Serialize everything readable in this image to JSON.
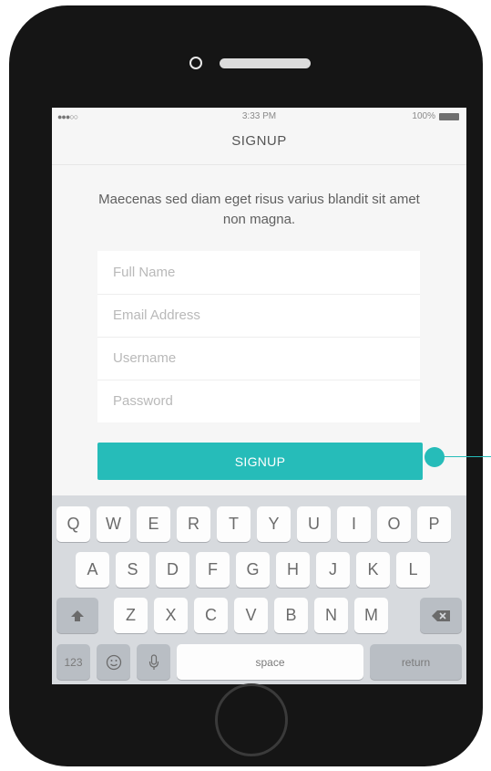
{
  "status_bar": {
    "signal": "●●●○○",
    "time": "3:33 PM",
    "battery": "100%"
  },
  "nav": {
    "title": "SIGNUP"
  },
  "intro_text": "Maecenas sed diam eget risus varius blandit sit amet non magna.",
  "form": {
    "fields": [
      {
        "placeholder": "Full Name",
        "value": ""
      },
      {
        "placeholder": "Email Address",
        "value": ""
      },
      {
        "placeholder": "Username",
        "value": ""
      },
      {
        "placeholder": "Password",
        "value": ""
      }
    ],
    "submit_label": "SIGNUP"
  },
  "keyboard": {
    "row1": [
      "Q",
      "W",
      "E",
      "R",
      "T",
      "Y",
      "U",
      "I",
      "O",
      "P"
    ],
    "row2": [
      "A",
      "S",
      "D",
      "F",
      "G",
      "H",
      "J",
      "K",
      "L"
    ],
    "row3": [
      "Z",
      "X",
      "C",
      "V",
      "B",
      "N",
      "M"
    ],
    "numbers_label": "123",
    "space_label": "space",
    "return_label": "return",
    "icons": {
      "shift": "shift-icon",
      "backspace": "backspace-icon",
      "emoji": "emoji-icon",
      "mic": "microphone-icon"
    }
  },
  "colors": {
    "accent": "#26bcb9",
    "phone_body": "#151515",
    "screen_bg": "#f6f6f6",
    "keyboard_bg": "#d7dade"
  }
}
